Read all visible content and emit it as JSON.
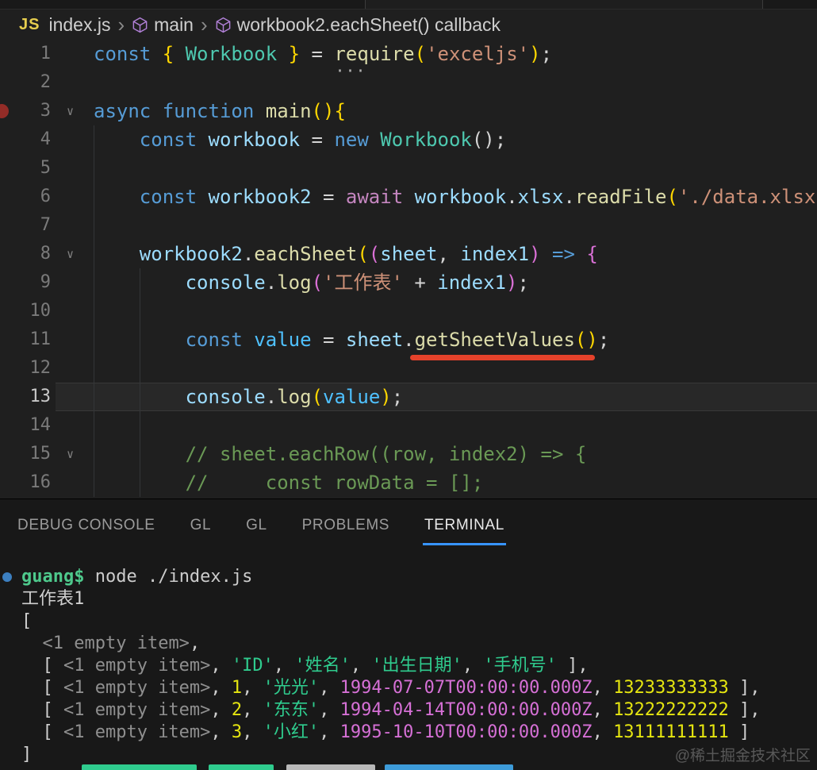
{
  "breadcrumb": {
    "file_badge": "JS",
    "file_name": "index.js",
    "separator": "›",
    "symbol1": "main",
    "symbol2": "workbook2.eachSheet() callback"
  },
  "editor": {
    "lines": [
      {
        "n": "1",
        "tokens": [
          {
            "t": "const ",
            "c": "kw"
          },
          {
            "t": "{ ",
            "c": "gold"
          },
          {
            "t": "Workbook",
            "c": "cls"
          },
          {
            "t": " }",
            "c": "gold"
          },
          {
            "t": " = ",
            "c": "pun"
          },
          {
            "t": "require",
            "c": "fn",
            "dots": true
          },
          {
            "t": "(",
            "c": "gold"
          },
          {
            "t": "'exceljs'",
            "c": "str"
          },
          {
            "t": ")",
            "c": "gold"
          },
          {
            "t": ";",
            "c": "pun"
          }
        ]
      },
      {
        "n": "2",
        "tokens": []
      },
      {
        "n": "3",
        "bp": true,
        "fold": true,
        "tokens": [
          {
            "t": "async",
            "c": "kw"
          },
          {
            "t": " ",
            "c": "pun"
          },
          {
            "t": "function",
            "c": "kw"
          },
          {
            "t": " ",
            "c": "pun"
          },
          {
            "t": "main",
            "c": "fn"
          },
          {
            "t": "(){",
            "c": "gold"
          }
        ]
      },
      {
        "n": "4",
        "tokens": [
          {
            "t": "    ",
            "c": "pun"
          },
          {
            "t": "const ",
            "c": "kw"
          },
          {
            "t": "workbook",
            "c": "var"
          },
          {
            "t": " = ",
            "c": "pun"
          },
          {
            "t": "new ",
            "c": "kw"
          },
          {
            "t": "Workbook",
            "c": "cls"
          },
          {
            "t": "()",
            "c": "pun"
          },
          {
            "t": ";",
            "c": "pun"
          }
        ]
      },
      {
        "n": "5",
        "tokens": []
      },
      {
        "n": "6",
        "tokens": [
          {
            "t": "    ",
            "c": "pun"
          },
          {
            "t": "const ",
            "c": "kw"
          },
          {
            "t": "workbook2",
            "c": "var"
          },
          {
            "t": " = ",
            "c": "pun"
          },
          {
            "t": "await ",
            "c": "ctl"
          },
          {
            "t": "workbook",
            "c": "var"
          },
          {
            "t": ".",
            "c": "pun"
          },
          {
            "t": "xlsx",
            "c": "var"
          },
          {
            "t": ".",
            "c": "pun"
          },
          {
            "t": "readFile",
            "c": "fn"
          },
          {
            "t": "(",
            "c": "gold"
          },
          {
            "t": "'./data.xlsx",
            "c": "str"
          }
        ]
      },
      {
        "n": "7",
        "tokens": []
      },
      {
        "n": "8",
        "fold": true,
        "tokens": [
          {
            "t": "    ",
            "c": "pun"
          },
          {
            "t": "workbook2",
            "c": "var"
          },
          {
            "t": ".",
            "c": "pun"
          },
          {
            "t": "eachSheet",
            "c": "fn"
          },
          {
            "t": "(",
            "c": "gold"
          },
          {
            "t": "(",
            "c": "orc"
          },
          {
            "t": "sheet",
            "c": "var"
          },
          {
            "t": ", ",
            "c": "pun"
          },
          {
            "t": "index1",
            "c": "var"
          },
          {
            "t": ")",
            "c": "orc"
          },
          {
            "t": " ",
            "c": "pun"
          },
          {
            "t": "=>",
            "c": "kw"
          },
          {
            "t": " ",
            "c": "pun"
          },
          {
            "t": "{",
            "c": "orc"
          }
        ]
      },
      {
        "n": "9",
        "tokens": [
          {
            "t": "        ",
            "c": "pun"
          },
          {
            "t": "console",
            "c": "var"
          },
          {
            "t": ".",
            "c": "pun"
          },
          {
            "t": "log",
            "c": "fn"
          },
          {
            "t": "(",
            "c": "orc"
          },
          {
            "t": "'工作表'",
            "c": "str"
          },
          {
            "t": " + ",
            "c": "pun"
          },
          {
            "t": "index1",
            "c": "var"
          },
          {
            "t": ")",
            "c": "orc"
          },
          {
            "t": ";",
            "c": "pun"
          }
        ]
      },
      {
        "n": "10",
        "tokens": []
      },
      {
        "n": "11",
        "tokens": [
          {
            "t": "        ",
            "c": "pun"
          },
          {
            "t": "const ",
            "c": "kw"
          },
          {
            "t": "value",
            "c": "var2"
          },
          {
            "t": " = ",
            "c": "pun"
          },
          {
            "t": "sheet",
            "c": "var"
          },
          {
            "t": ".",
            "c": "pun"
          },
          {
            "t": "getSheetValues",
            "c": "fn"
          },
          {
            "t": "()",
            "c": "gold"
          },
          {
            "t": ";",
            "c": "pun"
          }
        ]
      },
      {
        "n": "12",
        "tokens": []
      },
      {
        "n": "13",
        "cur": true,
        "tokens": [
          {
            "t": "        ",
            "c": "pun"
          },
          {
            "t": "console",
            "c": "var"
          },
          {
            "t": ".",
            "c": "pun"
          },
          {
            "t": "log",
            "c": "fn"
          },
          {
            "t": "(",
            "c": "gold"
          },
          {
            "t": "value",
            "c": "var2"
          },
          {
            "t": ")",
            "c": "gold"
          },
          {
            "t": ";",
            "c": "pun"
          }
        ]
      },
      {
        "n": "14",
        "tokens": []
      },
      {
        "n": "15",
        "fold": true,
        "tokens": [
          {
            "t": "        ",
            "c": "pun"
          },
          {
            "t": "// sheet.eachRow((row, index2) => {",
            "c": "com"
          }
        ]
      },
      {
        "n": "16",
        "tokens": [
          {
            "t": "        ",
            "c": "pun"
          },
          {
            "t": "//     const rowData = [];",
            "c": "com"
          }
        ]
      }
    ]
  },
  "panel": {
    "tabs": [
      {
        "label": "DEBUG CONSOLE",
        "active": false
      },
      {
        "label": "GL",
        "active": false
      },
      {
        "label": "GL",
        "active": false
      },
      {
        "label": "PROBLEMS",
        "active": false
      },
      {
        "label": "TERMINAL",
        "active": true
      }
    ]
  },
  "terminal": {
    "lines": [
      {
        "dot": true,
        "tokens": [
          {
            "t": "guang$",
            "c": "prompt"
          },
          {
            "t": " node ./index.js",
            "c": "cmd"
          }
        ]
      },
      {
        "tokens": [
          {
            "t": "工作表1",
            "c": "wh"
          }
        ]
      },
      {
        "tokens": [
          {
            "t": "[",
            "c": "wh"
          }
        ]
      },
      {
        "tokens": [
          {
            "t": "  ",
            "c": "wh"
          },
          {
            "t": "<1 empty item>",
            "c": "dim"
          },
          {
            "t": ",",
            "c": "wh"
          }
        ]
      },
      {
        "tokens": [
          {
            "t": "  [ ",
            "c": "wh"
          },
          {
            "t": "<1 empty item>",
            "c": "dim"
          },
          {
            "t": ", ",
            "c": "wh"
          },
          {
            "t": "'ID'",
            "c": "grn"
          },
          {
            "t": ", ",
            "c": "wh"
          },
          {
            "t": "'姓名'",
            "c": "grn"
          },
          {
            "t": ", ",
            "c": "wh"
          },
          {
            "t": "'出生日期'",
            "c": "grn"
          },
          {
            "t": ", ",
            "c": "wh"
          },
          {
            "t": "'手机号'",
            "c": "grn"
          },
          {
            "t": " ],",
            "c": "wh"
          }
        ]
      },
      {
        "tokens": [
          {
            "t": "  [ ",
            "c": "wh"
          },
          {
            "t": "<1 empty item>",
            "c": "dim"
          },
          {
            "t": ", ",
            "c": "wh"
          },
          {
            "t": "1",
            "c": "yel"
          },
          {
            "t": ", ",
            "c": "wh"
          },
          {
            "t": "'光光'",
            "c": "grn"
          },
          {
            "t": ", ",
            "c": "wh"
          },
          {
            "t": "1994-07-07T00:00:00.000Z",
            "c": "mag"
          },
          {
            "t": ", ",
            "c": "wh"
          },
          {
            "t": "13233333333",
            "c": "yel"
          },
          {
            "t": " ],",
            "c": "wh"
          }
        ]
      },
      {
        "tokens": [
          {
            "t": "  [ ",
            "c": "wh"
          },
          {
            "t": "<1 empty item>",
            "c": "dim"
          },
          {
            "t": ", ",
            "c": "wh"
          },
          {
            "t": "2",
            "c": "yel"
          },
          {
            "t": ", ",
            "c": "wh"
          },
          {
            "t": "'东东'",
            "c": "grn"
          },
          {
            "t": ", ",
            "c": "wh"
          },
          {
            "t": "1994-04-14T00:00:00.000Z",
            "c": "mag"
          },
          {
            "t": ", ",
            "c": "wh"
          },
          {
            "t": "13222222222",
            "c": "yel"
          },
          {
            "t": " ],",
            "c": "wh"
          }
        ]
      },
      {
        "tokens": [
          {
            "t": "  [ ",
            "c": "wh"
          },
          {
            "t": "<1 empty item>",
            "c": "dim"
          },
          {
            "t": ", ",
            "c": "wh"
          },
          {
            "t": "3",
            "c": "yel"
          },
          {
            "t": ", ",
            "c": "wh"
          },
          {
            "t": "'小红'",
            "c": "grn"
          },
          {
            "t": ", ",
            "c": "wh"
          },
          {
            "t": "1995-10-10T00:00:00.000Z",
            "c": "mag"
          },
          {
            "t": ", ",
            "c": "wh"
          },
          {
            "t": "13111111111",
            "c": "yel"
          },
          {
            "t": " ]",
            "c": "wh"
          }
        ]
      },
      {
        "tokens": [
          {
            "t": "]",
            "c": "wh"
          }
        ]
      }
    ]
  },
  "watermark": "@稀土掘金技术社区",
  "colors": {
    "editor_bg": "#1f1f1f",
    "panel_bg": "#181818",
    "accent_tab_underline": "#3794FF",
    "red_marker": "#e5422b",
    "breakpoint": "#932c27",
    "terminal_dot": "#3c7fc0",
    "terminal_green": "#2fcc8e",
    "terminal_yellow": "#e5e510",
    "terminal_magenta": "#d670d6"
  }
}
